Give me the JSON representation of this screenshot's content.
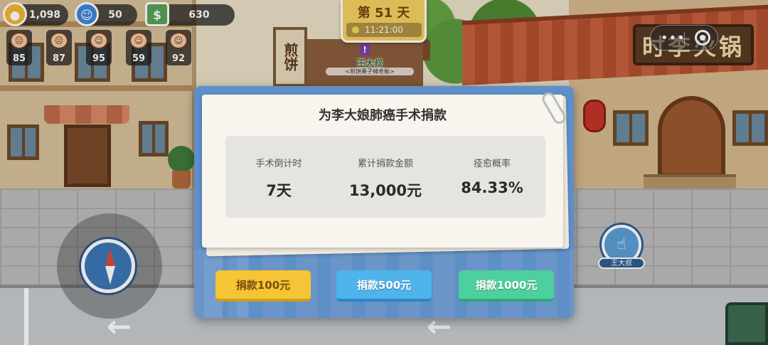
{
  "hud": {
    "coins": "1,098",
    "followers": "50",
    "cash": "630",
    "stats": [
      "85",
      "87",
      "95",
      "59",
      "92"
    ]
  },
  "day": {
    "label": "第 51 天",
    "time": "11:21:00"
  },
  "scene": {
    "jianbing_sign": "煎饼",
    "restaurant_sign": "时李火锅",
    "npc_name": "王大叔",
    "npc_title": "<煎饼果子摊老板>",
    "npc_marker": "!",
    "action_label": "王大叔"
  },
  "modal": {
    "title": "为李大娘肺癌手术捐款",
    "info": [
      {
        "label": "手术倒计时",
        "value": "7天"
      },
      {
        "label": "累计捐款金额",
        "value": "13,000元"
      },
      {
        "label": "痊愈概率",
        "value": "84.33%"
      }
    ],
    "buttons": [
      "捐款100元",
      "捐款500元",
      "捐款1000元"
    ]
  },
  "icons": {
    "coins": "coin-icon",
    "followers": "user-icon",
    "cash": "money-icon",
    "menu": "more-icon",
    "close": "target-icon",
    "joystick": "compass-icon",
    "action": "tap-icon"
  },
  "colors": {
    "coin": "#f2b631",
    "follower": "#3f86d9",
    "cash": "#5aa25a",
    "day_card": "#f5d262",
    "modal_bg": "#5f8fc7"
  }
}
